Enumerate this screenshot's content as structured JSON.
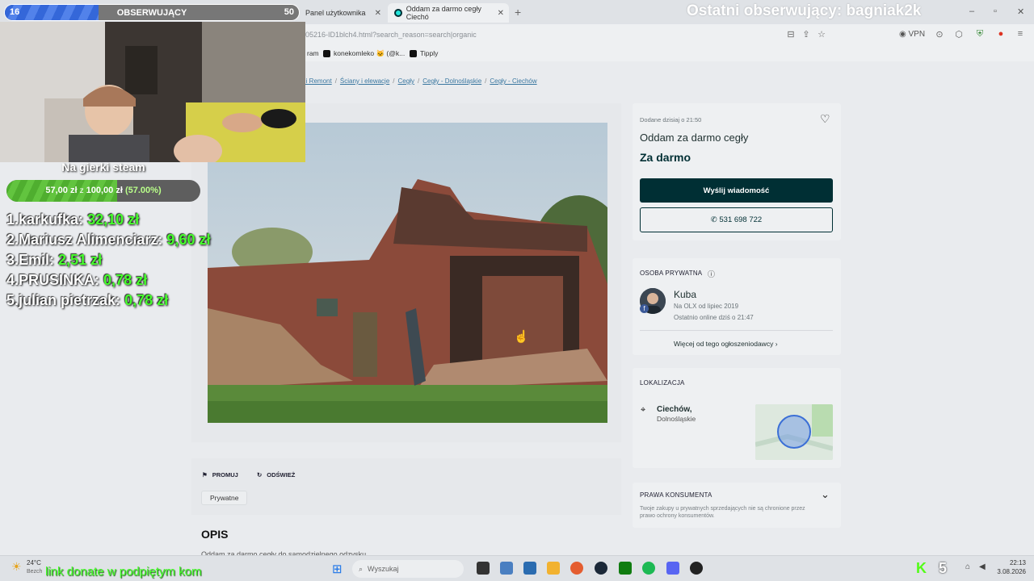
{
  "browser": {
    "tabs": [
      {
        "label": "Panel użytkownika",
        "active": false
      },
      {
        "label": "Oddam za darmo cegły Ciechó",
        "active": true
      }
    ],
    "url": "05216-ID1blch4.html?search_reason=search|organic",
    "vpn_label": "VPN",
    "bookmarks": [
      {
        "label": "ram"
      },
      {
        "label": "konekomleko 🐱 (@k..."
      },
      {
        "label": "Tipply"
      }
    ]
  },
  "breadcrumbs": [
    "a i Remont",
    "Ściany i elewacje",
    "Cegły",
    "Cegły - Dolnośląskie",
    "Cegły - Ciechów"
  ],
  "listing": {
    "added": "Dodane dzisiaj o 21:50",
    "title": "Oddam za darmo cegły",
    "price": "Za darmo",
    "message_button": "Wyślij wiadomość",
    "phone_button": "531 698 722",
    "seller_section": "OSOBA PRYWATNA",
    "seller_name": "Kuba",
    "seller_since": "Na OLX od lipiec 2019",
    "seller_online": "Ostatnio online dziś o 21:47",
    "more_ads": "Więcej od tego ogłoszeniodawcy",
    "location_section": "LOKALIZACJA",
    "city": "Ciechów,",
    "region": "Dolnośląskie",
    "consumer_section": "PRAWA KONSUMENTA",
    "consumer_note": "Twoje zakupy u prywatnych sprzedających nie są chronione przez prawo ochrony konsumentów.",
    "promote": "PROMUJ",
    "refresh": "ODŚWIEŻ",
    "tag": "Prywatne",
    "description_heading": "OPIS",
    "description_start": "Oddam za darmo cegły do samodzielnego odzysku"
  },
  "overlay": {
    "followers_current": "16",
    "followers_label": "OBSERWUJĄCY",
    "followers_goal": "50",
    "followers_progress": 0.32,
    "last_follower": "Ostatni obserwujący: bagniak2k",
    "goal_title": "Na gierki steam",
    "goal_raised": "57,00 zł",
    "goal_of": "z",
    "goal_target": "100,00 zł",
    "goal_percent": "(57.00%)",
    "goal_progress": 0.57,
    "donors": [
      {
        "rank": "1.",
        "name": "karkufka:",
        "amount": "32,10 zł"
      },
      {
        "rank": "2.",
        "name": "Mariusz Alimenciarz:",
        "amount": "9,60 zł"
      },
      {
        "rank": "3.",
        "name": "Emil:",
        "amount": "2,51 zł"
      },
      {
        "rank": "4.",
        "name": "PRUSINKA:",
        "amount": "0,78 zł"
      },
      {
        "rank": "5.",
        "name": "julian pietrzak:",
        "amount": "0,78 zł"
      }
    ],
    "donate_link": "link donate w podpiętym kom",
    "kick_badge": "5"
  },
  "taskbar": {
    "weather_temp": "24°C",
    "weather_sub": "Bezch",
    "search_placeholder": "Wyszukaj",
    "time": "22:13",
    "date": "3.08.2026"
  },
  "colors": {
    "olx_dark": "#002f34",
    "donor_green": "#47ff2e",
    "follow_blue": "#3467d9",
    "goal_green": "#4fae2f"
  }
}
